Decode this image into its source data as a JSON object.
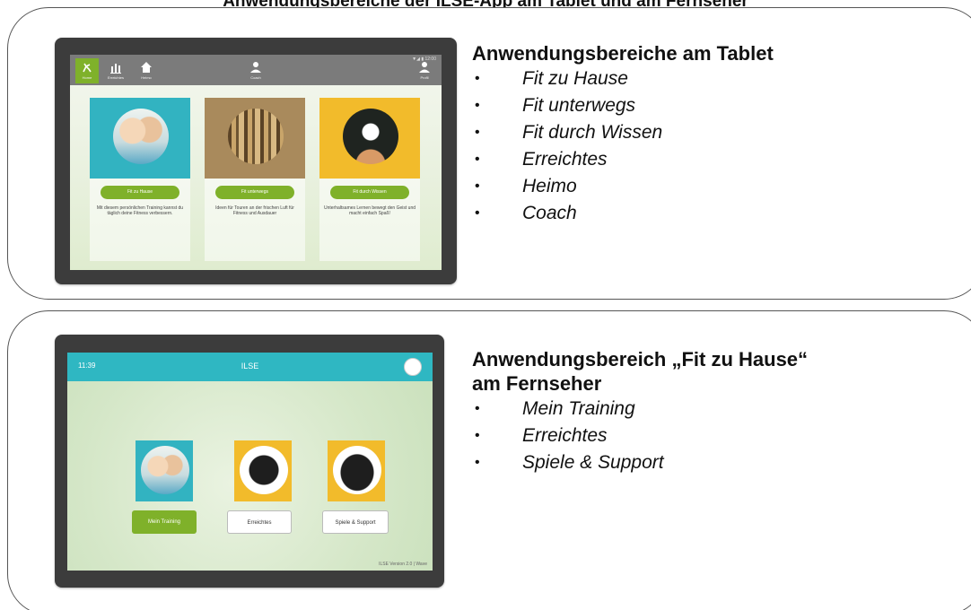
{
  "header": {
    "title": "Anwendungsbereiche der ILSE-App am Tablet und am Fernseher"
  },
  "tablet_section": {
    "heading": "Anwendungsbereiche am Tablet",
    "items": [
      "Fit zu Hause",
      "Fit unterwegs",
      "Fit durch Wissen",
      "Erreichtes",
      "Heimo",
      "Coach"
    ],
    "screen": {
      "status": "▼◢ ▮ 12:00",
      "nav": [
        {
          "label": "Home",
          "icon": "runner-icon"
        },
        {
          "label": "Erreichtes",
          "icon": "bar-chart-icon"
        },
        {
          "label": "Heimo",
          "icon": "house-icon"
        },
        {
          "label": "Coach",
          "icon": "person-icon"
        },
        {
          "label": "Profil",
          "icon": "profile-icon"
        }
      ],
      "cards": [
        {
          "button": "Fit zu Hause",
          "description": "Mit diesem persönlichen Training kannst du täglich deine Fitness verbessern."
        },
        {
          "button": "Fit unterwegs",
          "description": "Ideen für Touren an der frischen Luft für Fitness und Ausdauer"
        },
        {
          "button": "Fit durch Wissen",
          "description": "Unterhaltsames Lernen bewegt den Geist und macht einfach Spaß!"
        }
      ]
    }
  },
  "tv_section": {
    "heading_line1": "Anwendungsbereich „Fit zu Hause“",
    "heading_line2": "am Fernseher",
    "items": [
      "Mein Training",
      "Erreichtes",
      "Spiele & Support"
    ],
    "screen": {
      "time": "11:39",
      "title": "ILSE",
      "buttons": [
        "Mein Training",
        "Erreichtes",
        "Spiele & Support"
      ],
      "footer": "ILSE Version 2.0 | Wave"
    }
  },
  "colors": {
    "accent_green": "#7fb12a",
    "tv_teal": "#2fb7c2",
    "tile_teal": "#32b3c1",
    "tile_gold": "#f2bb2b",
    "tile_brown": "#a98a5c"
  }
}
